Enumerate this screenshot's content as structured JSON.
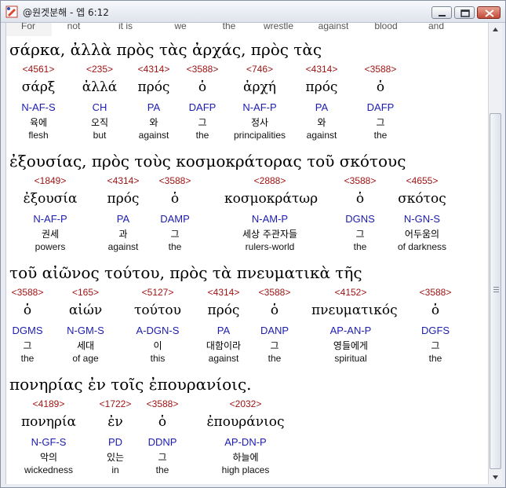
{
  "window": {
    "title": "@원겟분해 - 엡 6:12",
    "minimize": "minimize-icon",
    "maximize": "maximize-icon",
    "close": "close-icon"
  },
  "header_strip": [
    "For",
    "not",
    "it is",
    "we",
    "the",
    "wrestle",
    "against",
    "blood",
    "and"
  ],
  "lines": [
    {
      "greek": "σάρκα,  ἀλλὰ  πρὸς  τὰς  ἀρχάς,  πρὸς   τὰς",
      "words": [
        {
          "num": "<4561>",
          "lemma": "σάρξ",
          "parse": "N-AF-S",
          "korean": "육에",
          "english": "flesh"
        },
        {
          "num": "<235>",
          "lemma": "ἀλλά",
          "parse": "CH",
          "korean": "오직",
          "english": "but"
        },
        {
          "num": "<4314>",
          "lemma": "πρός",
          "parse": "PA",
          "korean": "와",
          "english": "against"
        },
        {
          "num": "<3588>",
          "lemma": "ὁ",
          "parse": "DAFP",
          "korean": "그",
          "english": "the"
        },
        {
          "num": "<746>",
          "lemma": "ἀρχή",
          "parse": "N-AF-P",
          "korean": "정사",
          "english": "principalities"
        },
        {
          "num": "<4314>",
          "lemma": "πρός",
          "parse": "PA",
          "korean": "와",
          "english": "against"
        },
        {
          "num": "<3588>",
          "lemma": "ὁ",
          "parse": "DAFP",
          "korean": "그",
          "english": "the"
        }
      ]
    },
    {
      "greek": "ἐξουσίας,  πρὸς  τοὺς  κοσμοκράτορας  τοῦ  σκότους",
      "words": [
        {
          "num": "<1849>",
          "lemma": "ἐξουσία",
          "parse": "N-AF-P",
          "korean": "권세",
          "english": "powers"
        },
        {
          "num": "<4314>",
          "lemma": "πρός",
          "parse": "PA",
          "korean": "과",
          "english": "against"
        },
        {
          "num": "<3588>",
          "lemma": "ὁ",
          "parse": "DAMP",
          "korean": "그",
          "english": "the"
        },
        {
          "num": "<2888>",
          "lemma": "κοσμοκράτωρ",
          "parse": "N-AM-P",
          "korean": "세상 주관자들",
          "english": "rulers-world"
        },
        {
          "num": "<3588>",
          "lemma": "ὁ",
          "parse": "DGNS",
          "korean": "그",
          "english": "the"
        },
        {
          "num": "<4655>",
          "lemma": "σκότος",
          "parse": "N-GN-S",
          "korean": "어두움의",
          "english": "of darkness"
        }
      ]
    },
    {
      "greek": "τοῦ  αἰῶνος  τούτου,  πρὸς   τὰ   πνευματικὰ  τῆς",
      "words": [
        {
          "num": "<3588>",
          "lemma": "ὁ",
          "parse": "DGMS",
          "korean": "그",
          "english": "the"
        },
        {
          "num": "<165>",
          "lemma": "αἰών",
          "parse": "N-GM-S",
          "korean": "세대",
          "english": "of age"
        },
        {
          "num": "<5127>",
          "lemma": "τούτου",
          "parse": "A-DGN-S",
          "korean": "이",
          "english": "this"
        },
        {
          "num": "<4314>",
          "lemma": "πρός",
          "parse": "PA",
          "korean": "대함이라",
          "english": "against"
        },
        {
          "num": "<3588>",
          "lemma": "ὁ",
          "parse": "DANP",
          "korean": "그",
          "english": "the"
        },
        {
          "num": "<4152>",
          "lemma": "πνευματικός",
          "parse": "AP-AN-P",
          "korean": "영들에게",
          "english": "spiritual"
        },
        {
          "num": "<3588>",
          "lemma": "ὁ",
          "parse": "DGFS",
          "korean": "그",
          "english": "the"
        }
      ]
    },
    {
      "greek": "πονηρίας  ἐν  τοῖς  ἐπουρανίοις.",
      "words": [
        {
          "num": "<4189>",
          "lemma": "πονηρία",
          "parse": "N-GF-S",
          "korean": "악의",
          "english": "wickedness"
        },
        {
          "num": "<1722>",
          "lemma": "ἐν",
          "parse": "PD",
          "korean": "있는",
          "english": "in"
        },
        {
          "num": "<3588>",
          "lemma": "ὁ",
          "parse": "DDNP",
          "korean": "그",
          "english": "the"
        },
        {
          "num": "<2032>",
          "lemma": "ἐπουράνιος",
          "parse": "AP-DN-P",
          "korean": "하늘에",
          "english": "high places"
        }
      ]
    }
  ],
  "colors": {
    "strongs_number": "#a01313",
    "parsing_code": "#1c1cb0"
  }
}
